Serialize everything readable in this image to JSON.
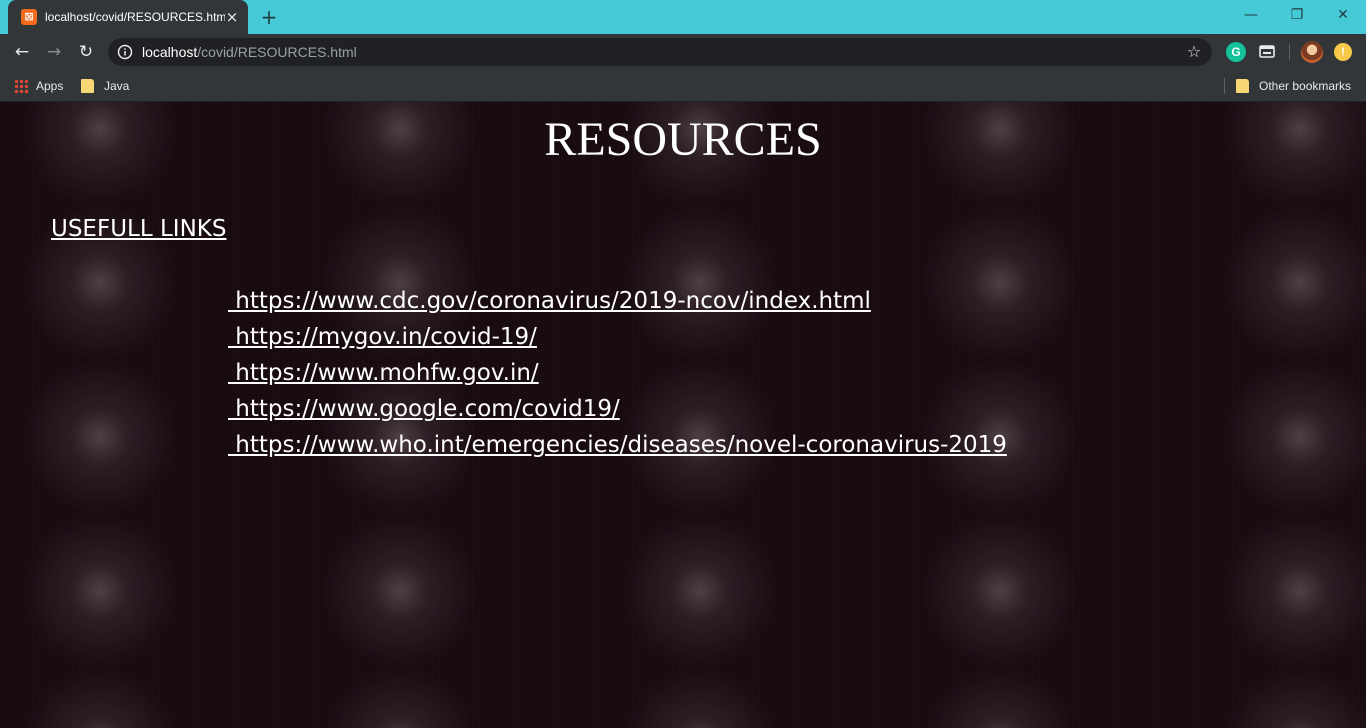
{
  "browser": {
    "tab": {
      "title": "localhost/covid/RESOURCES.html",
      "close_glyph": "×",
      "favicon_letter": "⊠",
      "favicon_color": "#f26b1d"
    },
    "new_tab_glyph": "+",
    "window_controls": {
      "minimize": "—",
      "restore": "❐",
      "close": "✕"
    },
    "nav": {
      "back": "←",
      "forward": "→",
      "reload": "↻"
    },
    "omnibox": {
      "host": "localhost",
      "path": "/covid/RESOURCES.html",
      "star_glyph": "☆"
    },
    "extensions": {
      "grammarly": "G",
      "coin": "!"
    },
    "bookmarks": {
      "apps": "Apps",
      "java": "Java",
      "other": "Other bookmarks"
    },
    "colors": {
      "tabstrip": "#46cad7",
      "toolbar": "#323639",
      "omnibox": "#202124"
    }
  },
  "page": {
    "title": "RESOURCES",
    "section_heading": "USEFULL LINKS",
    "links": [
      " https://www.cdc.gov/coronavirus/2019-ncov/index.html",
      " https://mygov.in/covid-19/",
      " https://www.mohfw.gov.in/",
      " https://www.google.com/covid19/",
      " https://www.who.int/emergencies/diseases/novel-coronavirus-2019"
    ],
    "colors": {
      "background": "#1a0c13",
      "text": "#ffffff"
    }
  }
}
